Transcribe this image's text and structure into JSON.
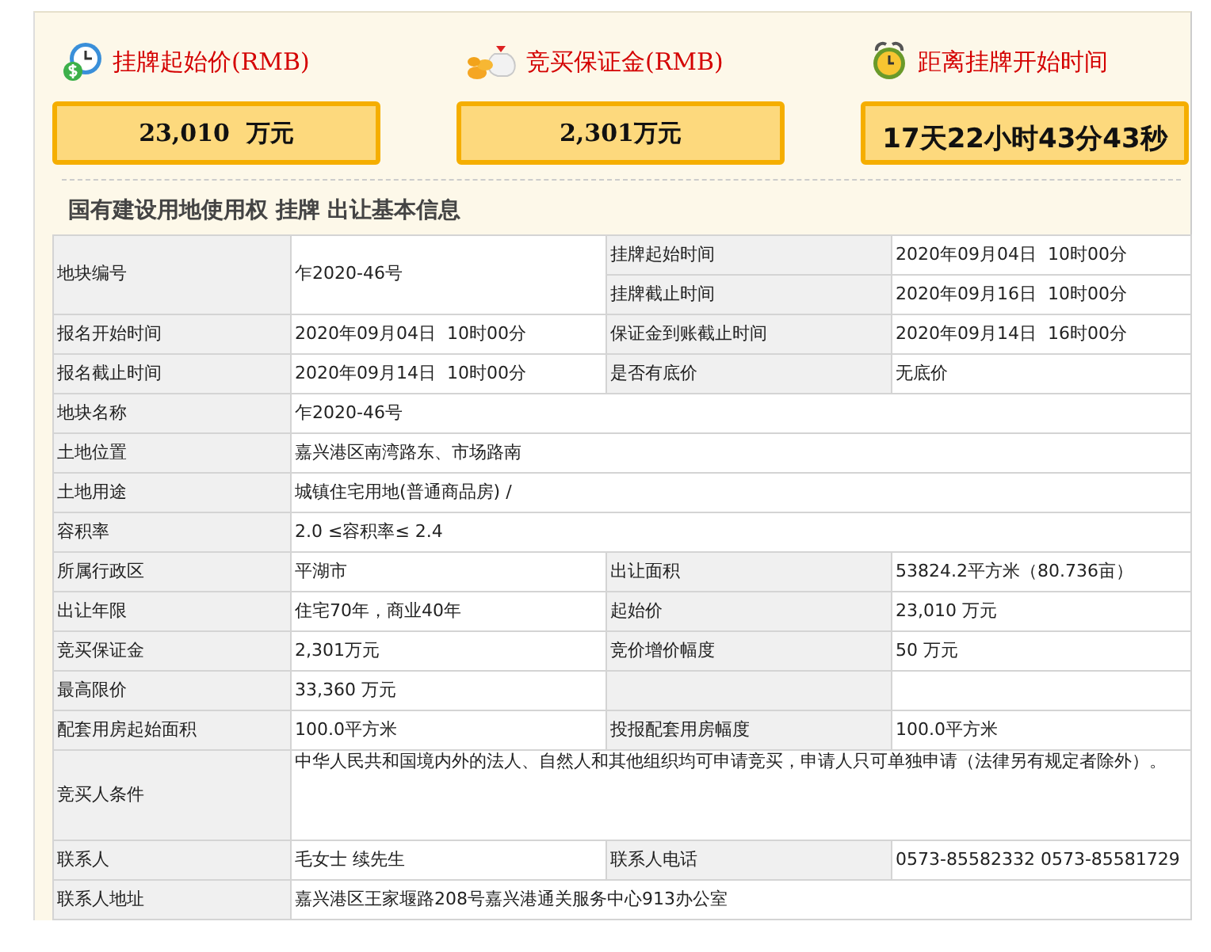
{
  "header_cards": [
    {
      "kind": "price",
      "title": "挂牌起始价(RMB)",
      "value": "23,010  万元"
    },
    {
      "kind": "deposit",
      "title": "竞买保证金(RMB)",
      "value": "2,301万元"
    },
    {
      "kind": "countdown",
      "title": "距离挂牌开始时间",
      "value": "17天22小时43分43秒"
    }
  ],
  "section_title": "国有建设用地使用权 挂牌 出让基本信息",
  "table": {
    "rows": [
      {
        "cells": [
          {
            "kind": "label",
            "text": "地块编号",
            "rowspan": 2
          },
          {
            "kind": "value",
            "text": "乍2020-46号",
            "rowspan": 2
          },
          {
            "kind": "label",
            "text": "挂牌起始时间"
          },
          {
            "kind": "value",
            "text": "2020年09月04日  10时00分"
          }
        ]
      },
      {
        "cells": [
          {
            "kind": "label",
            "text": "挂牌截止时间"
          },
          {
            "kind": "value",
            "text": "2020年09月16日  10时00分"
          }
        ]
      },
      {
        "cells": [
          {
            "kind": "label",
            "text": "报名开始时间"
          },
          {
            "kind": "value",
            "text": "2020年09月04日  10时00分"
          },
          {
            "kind": "label",
            "text": "保证金到账截止时间"
          },
          {
            "kind": "value",
            "text": "2020年09月14日  16时00分"
          }
        ]
      },
      {
        "cells": [
          {
            "kind": "label",
            "text": "报名截止时间"
          },
          {
            "kind": "value",
            "text": "2020年09月14日  10时00分"
          },
          {
            "kind": "label",
            "text": "是否有底价"
          },
          {
            "kind": "value",
            "text": "无底价"
          }
        ]
      },
      {
        "cells": [
          {
            "kind": "label",
            "text": "地块名称"
          },
          {
            "kind": "value",
            "text": "乍2020-46号",
            "colspan": 3
          }
        ]
      },
      {
        "cells": [
          {
            "kind": "label",
            "text": "土地位置"
          },
          {
            "kind": "value",
            "text": "嘉兴港区南湾路东、市场路南",
            "colspan": 3
          }
        ]
      },
      {
        "cells": [
          {
            "kind": "label",
            "text": "土地用途"
          },
          {
            "kind": "value",
            "text": "城镇住宅用地(普通商品房) /",
            "colspan": 3
          }
        ]
      },
      {
        "cells": [
          {
            "kind": "label",
            "text": "容积率"
          },
          {
            "kind": "value",
            "text": "2.0 ≤容积率≤ 2.4",
            "colspan": 3
          }
        ]
      },
      {
        "cells": [
          {
            "kind": "label",
            "text": "所属行政区"
          },
          {
            "kind": "value",
            "text": "平湖市"
          },
          {
            "kind": "label",
            "text": "出让面积"
          },
          {
            "kind": "value",
            "text": "53824.2平方米（80.736亩）"
          }
        ]
      },
      {
        "cells": [
          {
            "kind": "label",
            "text": "出让年限"
          },
          {
            "kind": "value",
            "text": "住宅70年，商业40年"
          },
          {
            "kind": "label",
            "text": "起始价"
          },
          {
            "kind": "value",
            "text": "23,010 万元"
          }
        ]
      },
      {
        "cells": [
          {
            "kind": "label",
            "text": "竞买保证金"
          },
          {
            "kind": "value",
            "text": "2,301万元"
          },
          {
            "kind": "label",
            "text": "竞价增价幅度"
          },
          {
            "kind": "value",
            "text": "50 万元"
          }
        ]
      },
      {
        "cells": [
          {
            "kind": "label",
            "text": "最高限价"
          },
          {
            "kind": "value",
            "text": "33,360 万元"
          },
          {
            "kind": "label"
          },
          {
            "kind": "value"
          }
        ]
      },
      {
        "cells": [
          {
            "kind": "label",
            "text": "配套用房起始面积"
          },
          {
            "kind": "value",
            "text": "100.0平方米"
          },
          {
            "kind": "label",
            "text": "投报配套用房幅度"
          },
          {
            "kind": "value",
            "text": "100.0平方米"
          }
        ]
      },
      {
        "kind": "tall",
        "cells": [
          {
            "kind": "label",
            "text": "竞买人条件"
          },
          {
            "kind": "value",
            "text": "中华人民共和国境内外的法人、自然人和其他组织均可申请竞买，申请人只可单独申请（法律另有规定者除外）。",
            "colspan": 3
          }
        ]
      },
      {
        "cells": [
          {
            "kind": "label",
            "text": "联系人"
          },
          {
            "kind": "value",
            "text": "毛女士 续先生"
          },
          {
            "kind": "label",
            "text": "联系人电话"
          },
          {
            "kind": "value",
            "text": "0573-85582332 0573-85581729"
          }
        ]
      },
      {
        "cells": [
          {
            "kind": "label",
            "text": "联系人地址"
          },
          {
            "kind": "value",
            "text": "嘉兴港区王家堰路208号嘉兴港通关服务中心913办公室",
            "colspan": 3
          }
        ]
      }
    ]
  }
}
